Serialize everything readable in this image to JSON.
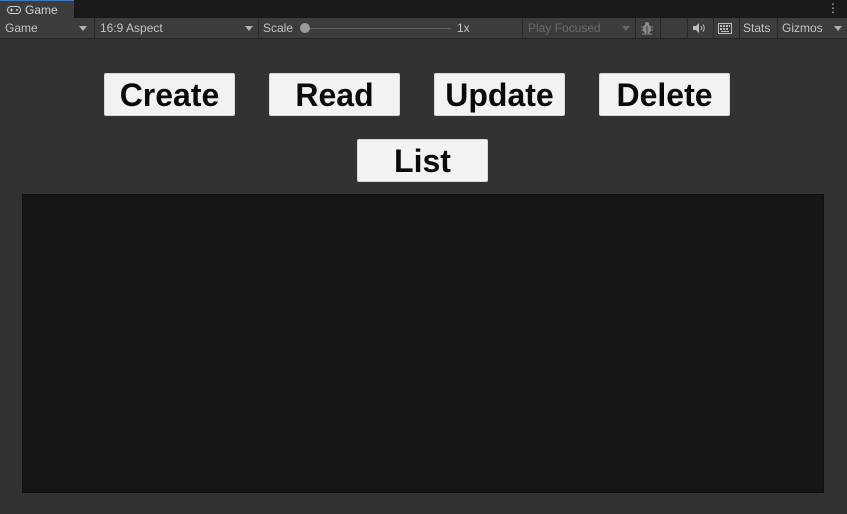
{
  "tab": {
    "label": "Game",
    "menu_icon": "kebab-menu-icon"
  },
  "toolbar": {
    "display_select": "Game",
    "aspect_select": "16:9 Aspect",
    "scale_label": "Scale",
    "scale_value": "1x",
    "play_mode_select": "Play Focused",
    "stats_label": "Stats",
    "gizmos_label": "Gizmos"
  },
  "buttons": {
    "create": "Create",
    "read": "Read",
    "update": "Update",
    "delete": "Delete",
    "list": "List"
  },
  "colors": {
    "editor_bg": "#282828",
    "toolbar_bg": "#3c3c3c",
    "game_bg": "#323232",
    "button_bg": "#f3f3f3",
    "panel_bg": "#161616",
    "tab_accent": "#3a79bb"
  }
}
